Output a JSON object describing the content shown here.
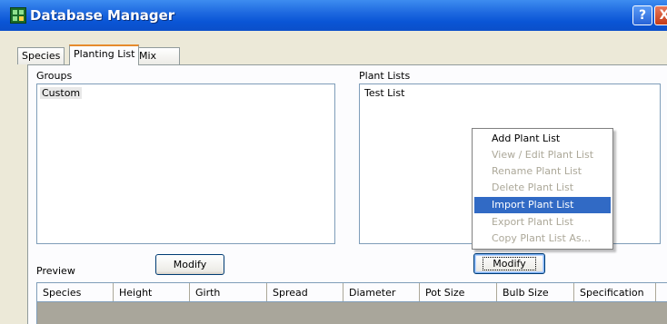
{
  "window": {
    "title": "Database Manager",
    "help_label": "?",
    "close_label": "X"
  },
  "tabs": [
    {
      "label": "Species"
    },
    {
      "label": "Planting List",
      "active": true
    },
    {
      "label": "Mix"
    }
  ],
  "groups": {
    "label": "Groups",
    "items": [
      "Custom"
    ],
    "modify_label": "Modify"
  },
  "plant_lists": {
    "label": "Plant Lists",
    "items": [
      "Test List"
    ],
    "modify_label": "Modify"
  },
  "context_menu": {
    "items": [
      {
        "label": "Add Plant List",
        "enabled": true
      },
      {
        "label": "View / Edit Plant List",
        "enabled": false
      },
      {
        "label": "Rename Plant List",
        "enabled": false
      },
      {
        "label": "Delete Plant List",
        "enabled": false
      },
      {
        "label": "Import Plant List",
        "enabled": true,
        "highlighted": true
      },
      {
        "label": "Export Plant List",
        "enabled": false
      },
      {
        "label": "Copy Plant List As...",
        "enabled": false
      }
    ]
  },
  "preview": {
    "label": "Preview",
    "columns": [
      "Species",
      "Height",
      "Girth",
      "Spread",
      "Diameter",
      "Pot Size",
      "Bulb Size",
      "Specification"
    ]
  }
}
